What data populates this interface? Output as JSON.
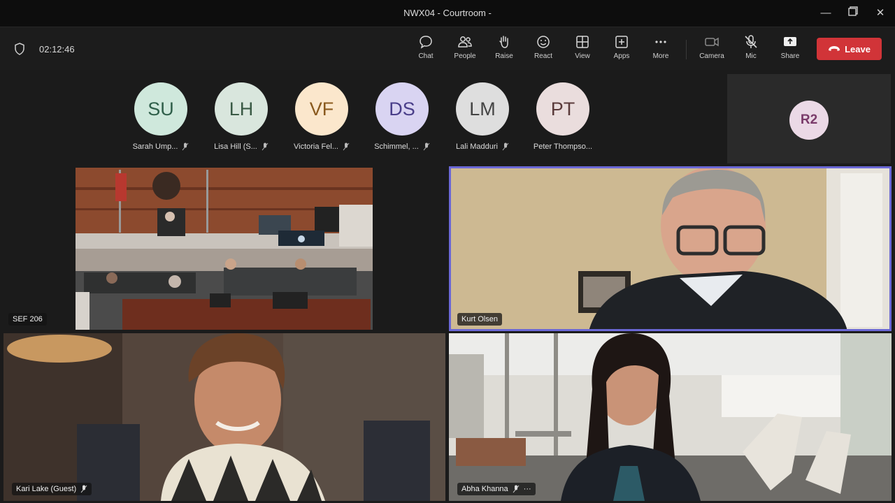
{
  "window": {
    "title": "NWX04 - Courtroom -"
  },
  "toolbar": {
    "timer": "02:12:46",
    "buttons": [
      {
        "label": "Chat",
        "icon": "chat-icon"
      },
      {
        "label": "People",
        "icon": "people-icon"
      },
      {
        "label": "Raise",
        "icon": "raise-hand-icon"
      },
      {
        "label": "React",
        "icon": "react-icon"
      },
      {
        "label": "View",
        "icon": "view-icon"
      },
      {
        "label": "Apps",
        "icon": "apps-icon"
      },
      {
        "label": "More",
        "icon": "more-icon"
      },
      {
        "label": "Camera",
        "icon": "camera-off-icon"
      },
      {
        "label": "Mic",
        "icon": "mic-off-icon"
      },
      {
        "label": "Share",
        "icon": "share-icon"
      }
    ],
    "leave_label": "Leave"
  },
  "roster": [
    {
      "initials": "SU",
      "name": "Sarah Ump...",
      "color": "#cfe8dc"
    },
    {
      "initials": "LH",
      "name": "Lisa Hill (S...",
      "color": "#d9e6dd"
    },
    {
      "initials": "VF",
      "name": "Victoria Fel...",
      "color": "#fbe7cc"
    },
    {
      "initials": "DS",
      "name": "Schimmel, ...",
      "color": "#d9d4f2"
    },
    {
      "initials": "LM",
      "name": "Lali Madduri",
      "color": "#dedede"
    },
    {
      "initials": "PT",
      "name": "Peter Thompso...",
      "color": "#eadddd"
    }
  ],
  "overflow_avatar": {
    "initials": "R2",
    "color": "#ebd9e6"
  },
  "tiles": {
    "courtroom": {
      "name": "SEF 206"
    },
    "speaker": {
      "name": "Kurt Olsen"
    },
    "guest": {
      "name": "Kari Lake (Guest)"
    },
    "attorney": {
      "name": "Abha Khanna"
    }
  },
  "colors": {
    "leave": "#d13438",
    "active_border": "#6b68d6"
  }
}
